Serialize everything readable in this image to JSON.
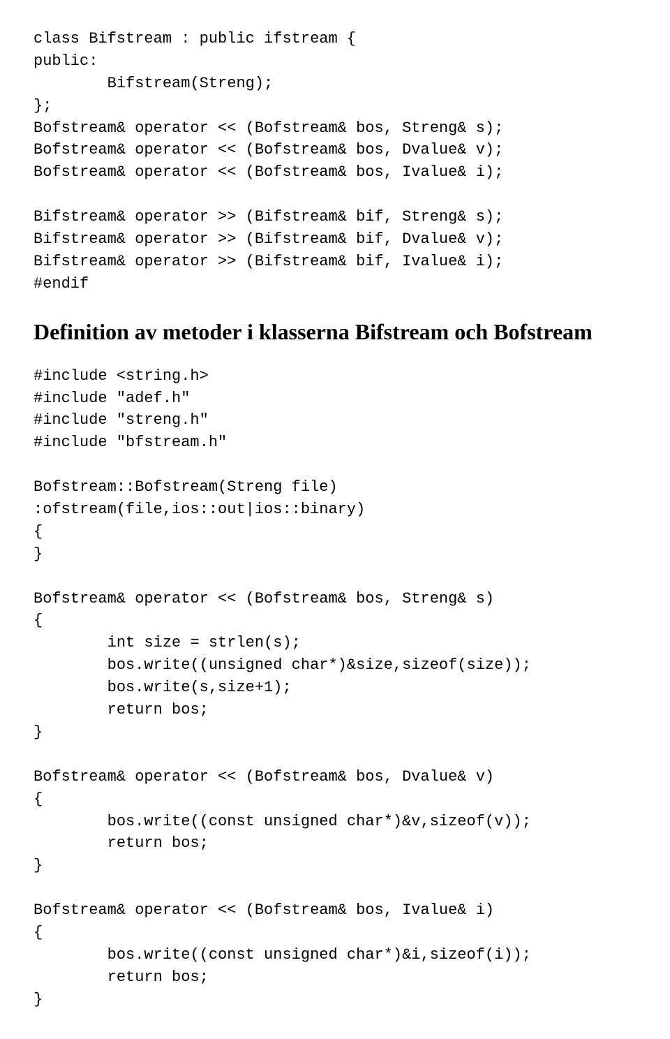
{
  "codeBlock1": "class Bifstream : public ifstream {\npublic:\n        Bifstream(Streng);\n};\nBofstream& operator << (Bofstream& bos, Streng& s);\nBofstream& operator << (Bofstream& bos, Dvalue& v);\nBofstream& operator << (Bofstream& bos, Ivalue& i);\n\nBifstream& operator >> (Bifstream& bif, Streng& s);\nBifstream& operator >> (Bifstream& bif, Dvalue& v);\nBifstream& operator >> (Bifstream& bif, Ivalue& i);\n#endif",
  "heading": "Definition av metoder i klasserna Bifstream och Bofstream",
  "codeBlock2": "#include <string.h>\n#include \"adef.h\"\n#include \"streng.h\"\n#include \"bfstream.h\"\n\nBofstream::Bofstream(Streng file)\n:ofstream(file,ios::out|ios::binary)\n{\n}\n\nBofstream& operator << (Bofstream& bos, Streng& s)\n{\n        int size = strlen(s);\n        bos.write((unsigned char*)&size,sizeof(size));\n        bos.write(s,size+1);\n        return bos;\n}\n\nBofstream& operator << (Bofstream& bos, Dvalue& v)\n{\n        bos.write((const unsigned char*)&v,sizeof(v));\n        return bos;\n}\n\nBofstream& operator << (Bofstream& bos, Ivalue& i)\n{\n        bos.write((const unsigned char*)&i,sizeof(i));\n        return bos;\n}"
}
